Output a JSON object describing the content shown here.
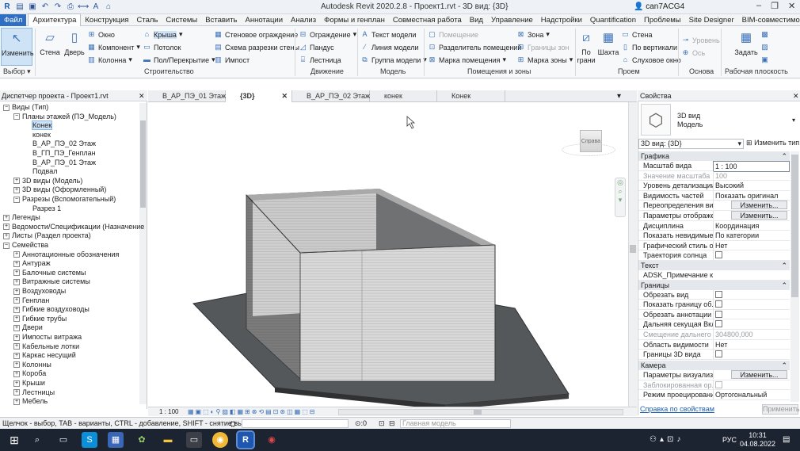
{
  "app": {
    "title": "Autodesk Revit 2020.2.8 - Проект1.rvt - 3D вид: {3D}",
    "user": "can7ACG4"
  },
  "menu": [
    "Файл",
    "Архитектура",
    "Конструкция",
    "Сталь",
    "Системы",
    "Вставить",
    "Аннотации",
    "Анализ",
    "Формы и генплан",
    "Совместная работа",
    "Вид",
    "Управление",
    "Надстройки",
    "Quantification",
    "Проблемы",
    "Site Designer",
    "BIM-совместимость"
  ],
  "ribbon": {
    "modify": "Изменить",
    "select": "Выбор ▾",
    "wall": "Стена",
    "door": "Дверь",
    "window": "Окно",
    "component": "Компонент",
    "column": "Колонна",
    "roof": "Крыша",
    "ceiling": "Потолок",
    "floor": "Пол/Перекрытие",
    "curtain_system": "Стеновое ограждение",
    "curtain_grid": "Схема разрезки стены",
    "mullion": "Импост",
    "railing": "Ограждение",
    "ramp": "Пандус",
    "stair": "Лестница",
    "model_text": "Текст модели",
    "model_line": "Линия модели",
    "model_group": "Группа модели",
    "room": "Помещение",
    "room_sep": "Разделитель помещений",
    "room_tag": "Марка помещения",
    "area": "Зона",
    "area_boundary": "Границы зон",
    "area_tag": "Марка зоны",
    "by_face": "По грани",
    "shaft": "Шахта",
    "wall_op": "Стена",
    "vertical": "По вертикали",
    "dormer": "Слуховое окно",
    "level": "Уровень",
    "grid": "Ось",
    "set": "Задать",
    "g_build": "Строительство",
    "g_circ": "Движение",
    "g_model": "Модель",
    "g_room": "Помещения и зоны",
    "g_opening": "Проем",
    "g_datum": "Основа",
    "g_work": "Рабочая плоскость"
  },
  "browser": {
    "header": "Диспетчер проекта - Проект1.rvt",
    "items": [
      "Виды (Тип)",
      "Планы этажей (ПЭ_Модель)",
      "Конек",
      "конек",
      "В_АР_ПЭ_02 Этаж",
      "В_ГП_ПЭ_Генплан",
      "В_АР_ПЭ_01 Этаж",
      "Подвал",
      "3D виды (Модель)",
      "3D виды (Оформленный)",
      "Разрезы (Вспомогательный)",
      "Разрез 1",
      "Легенды",
      "Ведомости/Спецификации (Назначение",
      "Листы (Раздел проекта)",
      "Семейства",
      "Аннотационные обозначения",
      "Антураж",
      "Балочные системы",
      "Витражные системы",
      "Воздуховоды",
      "Генплан",
      "Гибкие воздуховоды",
      "Гибкие трубы",
      "Двери",
      "Импосты витража",
      "Кабельные лотки",
      "Каркас несущий",
      "Колонны",
      "Короба",
      "Крыши",
      "Лестницы",
      "Мебель"
    ]
  },
  "tabs": [
    "В_АР_ПЭ_01 Этаж",
    "{3D}",
    "В_АР_ПЭ_02 Этаж",
    "конек",
    "Конек"
  ],
  "viewcube": "Справа",
  "viewbar": {
    "scale": "1 : 100"
  },
  "properties": {
    "header": "Свойства",
    "type": "3D вид",
    "family": "Модель",
    "selector": "3D вид: {3D}",
    "edit_type": "Изменить тип",
    "sec_graphics": "Графика",
    "sec_text": "Текст",
    "sec_bounds": "Границы",
    "sec_camera": "Камера",
    "r1k": "Масштаб вида",
    "r1v": "1 : 100",
    "r2k": "Значение масштаба",
    "r2v": "100",
    "r3k": "Уровень детализации",
    "r3v": "Высокий",
    "r4k": "Видимость частей",
    "r4v": "Показать оригинал",
    "r5k": "Переопределения ви...",
    "r6k": "Параметры отображе...",
    "edit": "Изменить...",
    "r7k": "Дисциплина",
    "r7v": "Координация",
    "r8k": "Показать невидимые ...",
    "r8v": "По категории",
    "r9k": "Графический стиль от...",
    "r9v": "Нет",
    "r10k": "Траектория солнца",
    "t1k": "ADSK_Примечание к ...",
    "b1k": "Обрезать вид",
    "b2k": "Показать границу об...",
    "b3k": "Обрезать аннотации",
    "b4k": "Дальняя секущая Вкл",
    "b5k": "Смещение дальнего ...",
    "b5v": "304800,000",
    "b6k": "Область видимости",
    "b6v": "Нет",
    "b7k": "Границы 3D вида",
    "c1k": "Параметры визуализ...",
    "c2k": "Заблокированная ор...",
    "c3k": "Режим проецирования",
    "c3v": "Ортогональный",
    "help": "Справка по свойствам",
    "apply": "Применить"
  },
  "status": {
    "text": "Щелчок - выбор, TAB - варианты, CTRL - добавление, SHIFT - снятие выбора.",
    "zero1": ":0",
    "model": "Главная модель"
  },
  "taskbar": {
    "lang": "РУС",
    "time": "10:31",
    "date": "04.08.2022"
  }
}
